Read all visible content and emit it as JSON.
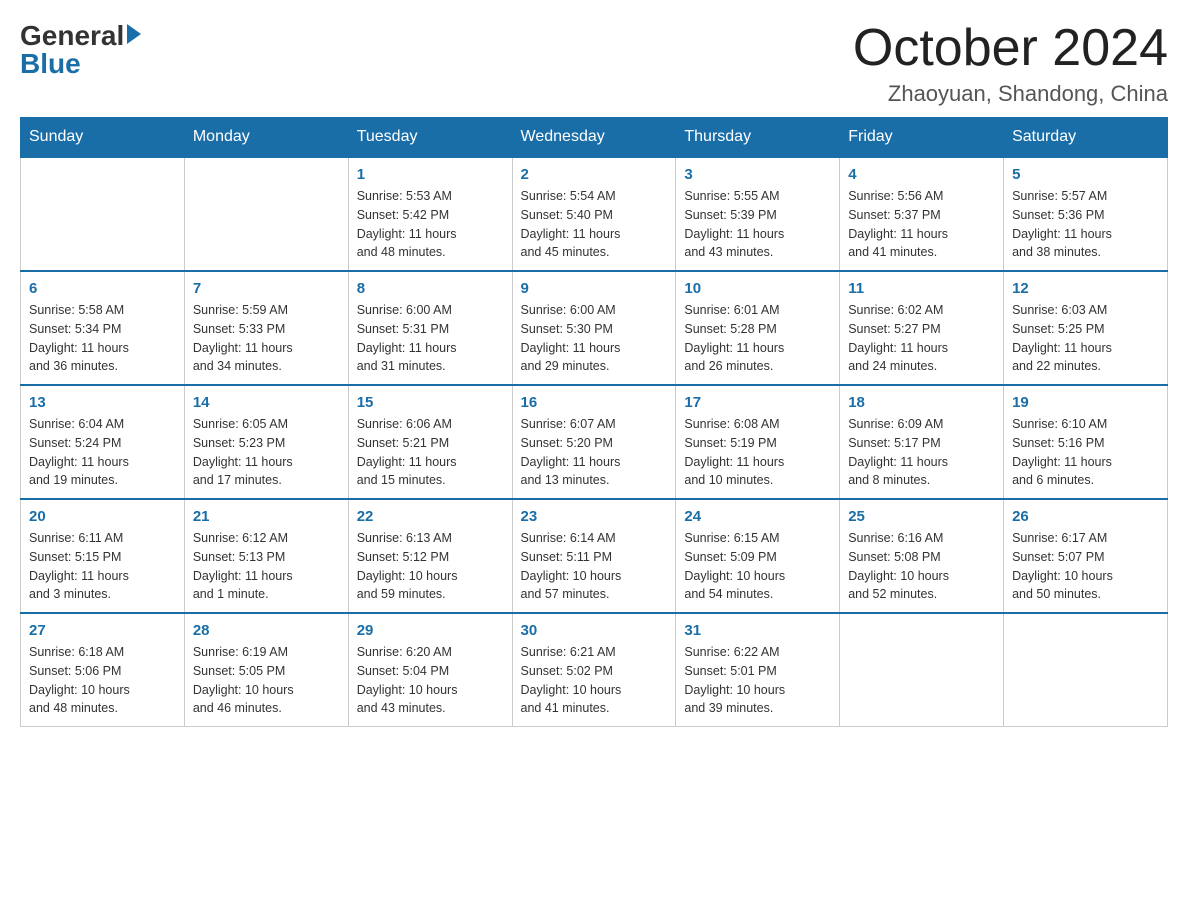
{
  "header": {
    "month_title": "October 2024",
    "location": "Zhaoyuan, Shandong, China",
    "logo_general": "General",
    "logo_blue": "Blue"
  },
  "weekdays": [
    "Sunday",
    "Monday",
    "Tuesday",
    "Wednesday",
    "Thursday",
    "Friday",
    "Saturday"
  ],
  "weeks": [
    [
      null,
      null,
      {
        "day": "1",
        "sunrise": "5:53 AM",
        "sunset": "5:42 PM",
        "daylight": "11 hours and 48 minutes."
      },
      {
        "day": "2",
        "sunrise": "5:54 AM",
        "sunset": "5:40 PM",
        "daylight": "11 hours and 45 minutes."
      },
      {
        "day": "3",
        "sunrise": "5:55 AM",
        "sunset": "5:39 PM",
        "daylight": "11 hours and 43 minutes."
      },
      {
        "day": "4",
        "sunrise": "5:56 AM",
        "sunset": "5:37 PM",
        "daylight": "11 hours and 41 minutes."
      },
      {
        "day": "5",
        "sunrise": "5:57 AM",
        "sunset": "5:36 PM",
        "daylight": "11 hours and 38 minutes."
      }
    ],
    [
      {
        "day": "6",
        "sunrise": "5:58 AM",
        "sunset": "5:34 PM",
        "daylight": "11 hours and 36 minutes."
      },
      {
        "day": "7",
        "sunrise": "5:59 AM",
        "sunset": "5:33 PM",
        "daylight": "11 hours and 34 minutes."
      },
      {
        "day": "8",
        "sunrise": "6:00 AM",
        "sunset": "5:31 PM",
        "daylight": "11 hours and 31 minutes."
      },
      {
        "day": "9",
        "sunrise": "6:00 AM",
        "sunset": "5:30 PM",
        "daylight": "11 hours and 29 minutes."
      },
      {
        "day": "10",
        "sunrise": "6:01 AM",
        "sunset": "5:28 PM",
        "daylight": "11 hours and 26 minutes."
      },
      {
        "day": "11",
        "sunrise": "6:02 AM",
        "sunset": "5:27 PM",
        "daylight": "11 hours and 24 minutes."
      },
      {
        "day": "12",
        "sunrise": "6:03 AM",
        "sunset": "5:25 PM",
        "daylight": "11 hours and 22 minutes."
      }
    ],
    [
      {
        "day": "13",
        "sunrise": "6:04 AM",
        "sunset": "5:24 PM",
        "daylight": "11 hours and 19 minutes."
      },
      {
        "day": "14",
        "sunrise": "6:05 AM",
        "sunset": "5:23 PM",
        "daylight": "11 hours and 17 minutes."
      },
      {
        "day": "15",
        "sunrise": "6:06 AM",
        "sunset": "5:21 PM",
        "daylight": "11 hours and 15 minutes."
      },
      {
        "day": "16",
        "sunrise": "6:07 AM",
        "sunset": "5:20 PM",
        "daylight": "11 hours and 13 minutes."
      },
      {
        "day": "17",
        "sunrise": "6:08 AM",
        "sunset": "5:19 PM",
        "daylight": "11 hours and 10 minutes."
      },
      {
        "day": "18",
        "sunrise": "6:09 AM",
        "sunset": "5:17 PM",
        "daylight": "11 hours and 8 minutes."
      },
      {
        "day": "19",
        "sunrise": "6:10 AM",
        "sunset": "5:16 PM",
        "daylight": "11 hours and 6 minutes."
      }
    ],
    [
      {
        "day": "20",
        "sunrise": "6:11 AM",
        "sunset": "5:15 PM",
        "daylight": "11 hours and 3 minutes."
      },
      {
        "day": "21",
        "sunrise": "6:12 AM",
        "sunset": "5:13 PM",
        "daylight": "11 hours and 1 minute."
      },
      {
        "day": "22",
        "sunrise": "6:13 AM",
        "sunset": "5:12 PM",
        "daylight": "10 hours and 59 minutes."
      },
      {
        "day": "23",
        "sunrise": "6:14 AM",
        "sunset": "5:11 PM",
        "daylight": "10 hours and 57 minutes."
      },
      {
        "day": "24",
        "sunrise": "6:15 AM",
        "sunset": "5:09 PM",
        "daylight": "10 hours and 54 minutes."
      },
      {
        "day": "25",
        "sunrise": "6:16 AM",
        "sunset": "5:08 PM",
        "daylight": "10 hours and 52 minutes."
      },
      {
        "day": "26",
        "sunrise": "6:17 AM",
        "sunset": "5:07 PM",
        "daylight": "10 hours and 50 minutes."
      }
    ],
    [
      {
        "day": "27",
        "sunrise": "6:18 AM",
        "sunset": "5:06 PM",
        "daylight": "10 hours and 48 minutes."
      },
      {
        "day": "28",
        "sunrise": "6:19 AM",
        "sunset": "5:05 PM",
        "daylight": "10 hours and 46 minutes."
      },
      {
        "day": "29",
        "sunrise": "6:20 AM",
        "sunset": "5:04 PM",
        "daylight": "10 hours and 43 minutes."
      },
      {
        "day": "30",
        "sunrise": "6:21 AM",
        "sunset": "5:02 PM",
        "daylight": "10 hours and 41 minutes."
      },
      {
        "day": "31",
        "sunrise": "6:22 AM",
        "sunset": "5:01 PM",
        "daylight": "10 hours and 39 minutes."
      },
      null,
      null
    ]
  ],
  "labels": {
    "sunrise": "Sunrise:",
    "sunset": "Sunset:",
    "daylight": "Daylight:"
  }
}
